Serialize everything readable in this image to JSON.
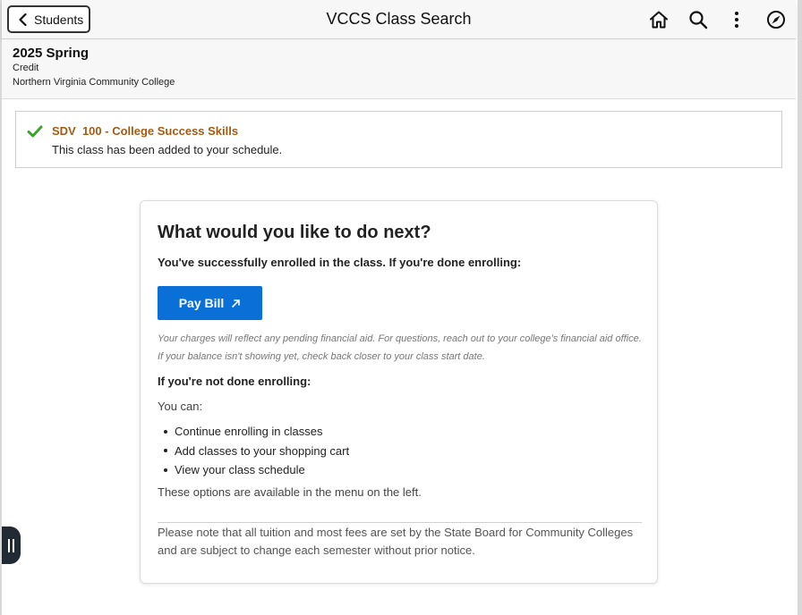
{
  "header": {
    "back_label": "Students",
    "title": "VCCS Class Search",
    "icons": [
      "home-icon",
      "search-icon",
      "more-options-icon",
      "navbar-compass-icon"
    ]
  },
  "term": {
    "name": "2025 Spring",
    "career": "Credit",
    "institution": "Northern Virginia Community College"
  },
  "message": {
    "icon": "success-check-icon",
    "class_title": "SDV  100 - College Success Skills",
    "text": "This class has been added to your schedule."
  },
  "next_steps": {
    "title": "What would you like to do next?",
    "enrolled_text": "You've successfully enrolled in the class. If you're done enrolling:",
    "pay_button_label": "Pay Bill",
    "pay_button_icon": "external-link-icon",
    "financial_note": "Your charges will reflect any pending financial aid. For questions, reach out to your college's financial aid office. If your balance isn't showing yet, check back closer to your class start date.",
    "not_done_heading": "If you're not done enrolling:",
    "you_can": "You can:",
    "options": [
      "Continue enrolling in classes",
      "Add classes to your shopping cart",
      "View your class schedule"
    ],
    "menu_note": "These options are available in the menu on the left.",
    "disclaimer": "Please note that all tuition and most fees are set by the State Board for Community Colleges and are subject to change each semester without prior notice."
  },
  "colors": {
    "accent_button": "#0b6fd8",
    "class_title": "#a35b12",
    "success_check": "#3fa32f",
    "side_tab": "#222a33"
  }
}
